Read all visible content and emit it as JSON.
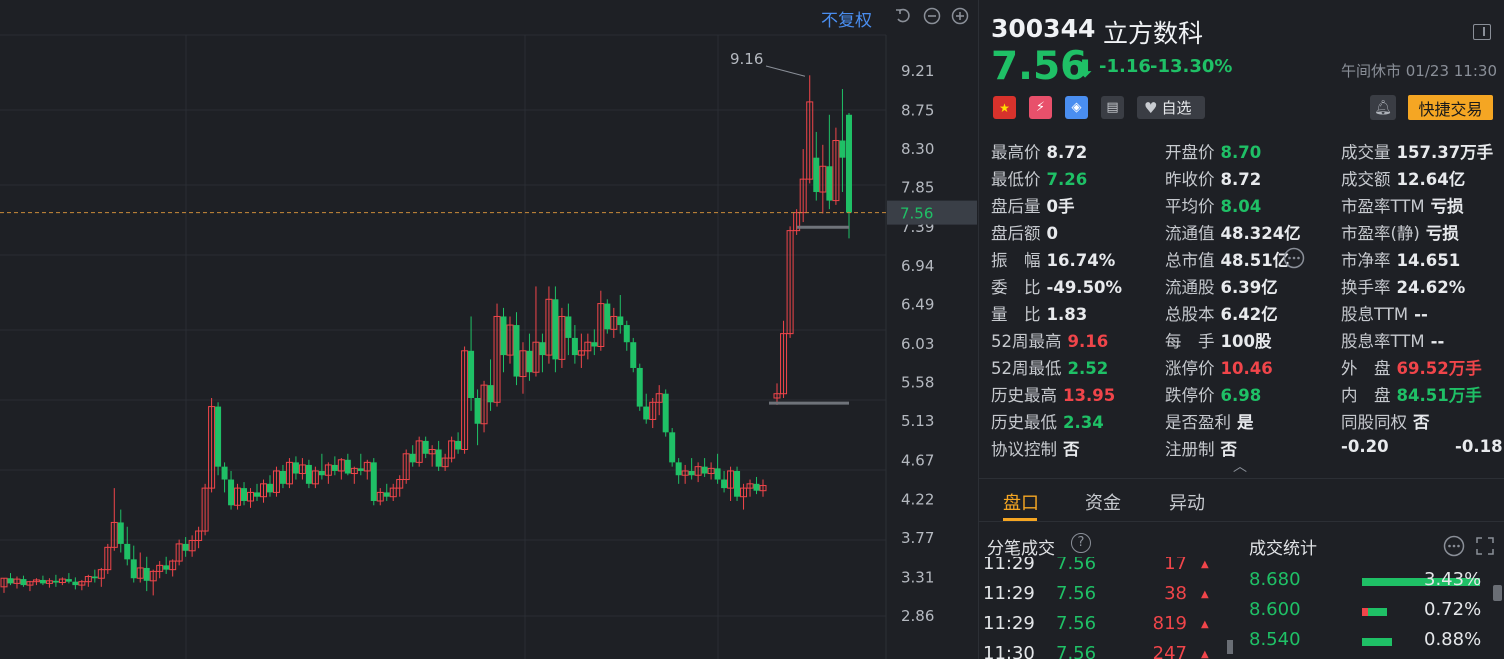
{
  "chart_data": {
    "type": "candlestick",
    "y_ticks": [
      "9.21",
      "8.75",
      "8.30",
      "7.85",
      "7.56",
      "7.39",
      "6.94",
      "6.49",
      "6.03",
      "5.58",
      "5.13",
      "4.67",
      "4.22",
      "3.77",
      "3.31",
      "2.86"
    ],
    "ylim": [
      2.86,
      9.21
    ],
    "current_price": 7.56,
    "max_label": "9.16",
    "up_color": "#f0454a",
    "down_color": "#1fc066",
    "candles": [
      [
        3.2,
        3.3,
        3.13,
        3.3
      ],
      [
        3.3,
        3.36,
        3.22,
        3.24
      ],
      [
        3.24,
        3.32,
        3.18,
        3.29
      ],
      [
        3.29,
        3.33,
        3.2,
        3.22
      ],
      [
        3.22,
        3.27,
        3.15,
        3.26
      ],
      [
        3.26,
        3.3,
        3.22,
        3.28
      ],
      [
        3.28,
        3.33,
        3.22,
        3.24
      ],
      [
        3.24,
        3.3,
        3.19,
        3.27
      ],
      [
        3.27,
        3.34,
        3.2,
        3.25
      ],
      [
        3.25,
        3.31,
        3.22,
        3.29
      ],
      [
        3.29,
        3.36,
        3.24,
        3.26
      ],
      [
        3.26,
        3.31,
        3.17,
        3.22
      ],
      [
        3.22,
        3.28,
        3.16,
        3.26
      ],
      [
        3.26,
        3.34,
        3.2,
        3.32
      ],
      [
        3.32,
        3.4,
        3.25,
        3.3
      ],
      [
        3.3,
        3.42,
        3.2,
        3.4
      ],
      [
        3.4,
        3.7,
        3.35,
        3.66
      ],
      [
        3.66,
        4.35,
        3.62,
        3.95
      ],
      [
        3.95,
        4.1,
        3.6,
        3.7
      ],
      [
        3.7,
        3.9,
        3.45,
        3.52
      ],
      [
        3.52,
        3.68,
        3.25,
        3.3
      ],
      [
        3.3,
        3.6,
        3.25,
        3.42
      ],
      [
        3.42,
        3.55,
        3.15,
        3.27
      ],
      [
        3.27,
        3.4,
        3.1,
        3.38
      ],
      [
        3.38,
        3.5,
        3.3,
        3.45
      ],
      [
        3.45,
        3.55,
        3.35,
        3.4
      ],
      [
        3.4,
        3.52,
        3.32,
        3.5
      ],
      [
        3.5,
        3.75,
        3.45,
        3.7
      ],
      [
        3.7,
        3.78,
        3.55,
        3.62
      ],
      [
        3.62,
        3.8,
        3.55,
        3.74
      ],
      [
        3.74,
        3.9,
        3.65,
        3.85
      ],
      [
        3.85,
        4.4,
        3.8,
        4.35
      ],
      [
        4.35,
        5.4,
        4.3,
        5.3
      ],
      [
        5.3,
        5.35,
        4.5,
        4.6
      ],
      [
        4.6,
        4.65,
        4.3,
        4.45
      ],
      [
        4.45,
        4.55,
        4.1,
        4.15
      ],
      [
        4.15,
        4.4,
        4.1,
        4.35
      ],
      [
        4.35,
        4.42,
        4.15,
        4.2
      ],
      [
        4.2,
        4.35,
        4.12,
        4.3
      ],
      [
        4.3,
        4.4,
        4.2,
        4.25
      ],
      [
        4.25,
        4.45,
        4.18,
        4.4
      ],
      [
        4.4,
        4.5,
        4.25,
        4.3
      ],
      [
        4.3,
        4.6,
        4.25,
        4.55
      ],
      [
        4.55,
        4.62,
        4.35,
        4.4
      ],
      [
        4.4,
        4.7,
        4.35,
        4.65
      ],
      [
        4.65,
        4.72,
        4.45,
        4.52
      ],
      [
        4.52,
        4.7,
        4.45,
        4.62
      ],
      [
        4.62,
        4.68,
        4.35,
        4.4
      ],
      [
        4.4,
        4.6,
        4.35,
        4.55
      ],
      [
        4.55,
        4.75,
        4.45,
        4.5
      ],
      [
        4.5,
        4.65,
        4.4,
        4.62
      ],
      [
        4.62,
        4.72,
        4.5,
        4.55
      ],
      [
        4.55,
        4.7,
        4.45,
        4.68
      ],
      [
        4.68,
        4.75,
        4.5,
        4.52
      ],
      [
        4.52,
        4.6,
        4.4,
        4.58
      ],
      [
        4.58,
        4.75,
        4.5,
        4.55
      ],
      [
        4.55,
        4.68,
        4.45,
        4.65
      ],
      [
        4.65,
        4.7,
        4.15,
        4.2
      ],
      [
        4.2,
        4.35,
        4.15,
        4.3
      ],
      [
        4.3,
        4.4,
        4.2,
        4.25
      ],
      [
        4.25,
        4.4,
        4.2,
        4.35
      ],
      [
        4.35,
        4.5,
        4.25,
        4.45
      ],
      [
        4.45,
        4.8,
        4.4,
        4.75
      ],
      [
        4.75,
        4.85,
        4.6,
        4.65
      ],
      [
        4.65,
        4.95,
        4.6,
        4.9
      ],
      [
        4.9,
        4.95,
        4.7,
        4.75
      ],
      [
        4.75,
        4.85,
        4.6,
        4.8
      ],
      [
        4.8,
        4.9,
        4.55,
        4.6
      ],
      [
        4.6,
        4.75,
        4.55,
        4.7
      ],
      [
        4.7,
        4.95,
        4.65,
        4.9
      ],
      [
        4.9,
        5.0,
        4.75,
        4.8
      ],
      [
        4.8,
        6.0,
        4.75,
        5.95
      ],
      [
        5.95,
        6.35,
        5.25,
        5.4
      ],
      [
        5.4,
        5.5,
        4.85,
        5.1
      ],
      [
        5.1,
        5.6,
        5.0,
        5.55
      ],
      [
        5.55,
        5.85,
        5.25,
        5.35
      ],
      [
        5.35,
        6.5,
        5.3,
        6.35
      ],
      [
        6.35,
        6.45,
        5.7,
        5.9
      ],
      [
        5.9,
        6.35,
        5.8,
        6.25
      ],
      [
        6.25,
        6.4,
        5.55,
        5.65
      ],
      [
        5.65,
        6.05,
        5.45,
        5.95
      ],
      [
        5.95,
        6.15,
        5.6,
        5.7
      ],
      [
        5.7,
        6.7,
        5.65,
        6.05
      ],
      [
        6.05,
        6.15,
        5.7,
        5.9
      ],
      [
        5.9,
        6.7,
        5.8,
        6.55
      ],
      [
        6.55,
        6.7,
        5.7,
        5.85
      ],
      [
        5.85,
        6.45,
        5.75,
        6.35
      ],
      [
        6.35,
        6.5,
        5.9,
        6.1
      ],
      [
        6.1,
        6.25,
        5.8,
        5.9
      ],
      [
        5.9,
        6.15,
        5.75,
        5.95
      ],
      [
        5.95,
        6.15,
        5.85,
        6.05
      ],
      [
        6.05,
        6.2,
        5.9,
        6.0
      ],
      [
        6.0,
        6.65,
        5.95,
        6.5
      ],
      [
        6.5,
        6.55,
        6.15,
        6.2
      ],
      [
        6.2,
        6.45,
        6.1,
        6.35
      ],
      [
        6.35,
        6.6,
        6.15,
        6.25
      ],
      [
        6.25,
        6.3,
        5.95,
        6.05
      ],
      [
        6.05,
        6.1,
        5.7,
        5.75
      ],
      [
        5.75,
        5.8,
        5.25,
        5.3
      ],
      [
        5.3,
        5.45,
        5.1,
        5.15
      ],
      [
        5.15,
        5.4,
        5.05,
        5.35
      ],
      [
        5.35,
        5.55,
        5.2,
        5.45
      ],
      [
        5.45,
        5.5,
        4.95,
        5.0
      ],
      [
        5.0,
        5.05,
        4.6,
        4.65
      ],
      [
        4.65,
        4.7,
        4.4,
        4.5
      ],
      [
        4.5,
        4.62,
        4.4,
        4.55
      ],
      [
        4.55,
        4.7,
        4.45,
        4.5
      ],
      [
        4.5,
        4.65,
        4.42,
        4.6
      ],
      [
        4.6,
        4.7,
        4.48,
        4.52
      ],
      [
        4.52,
        4.65,
        4.45,
        4.58
      ],
      [
        4.58,
        4.75,
        4.4,
        4.45
      ],
      [
        4.45,
        4.55,
        4.3,
        4.35
      ],
      [
        4.35,
        4.6,
        4.2,
        4.55
      ],
      [
        4.55,
        4.6,
        4.2,
        4.25
      ],
      [
        4.25,
        4.4,
        4.1,
        4.35
      ],
      [
        4.35,
        4.45,
        4.25,
        4.4
      ],
      [
        4.4,
        4.48,
        4.28,
        4.32
      ],
      [
        4.32,
        4.45,
        4.25,
        4.38
      ],
      [
        5.4,
        5.57,
        5.32,
        5.45
      ],
      [
        5.45,
        6.3,
        5.4,
        6.15
      ],
      [
        6.15,
        7.4,
        6.1,
        7.35
      ],
      [
        7.35,
        7.6,
        7.3,
        7.56
      ],
      [
        7.56,
        8.3,
        7.45,
        7.95
      ],
      [
        7.95,
        9.16,
        7.9,
        8.85
      ],
      [
        8.2,
        8.5,
        7.7,
        7.8
      ],
      [
        7.8,
        8.35,
        7.55,
        8.1
      ],
      [
        8.1,
        8.7,
        7.6,
        7.7
      ],
      [
        7.7,
        8.55,
        7.65,
        8.4
      ],
      [
        8.4,
        9.0,
        7.8,
        8.2
      ],
      [
        8.7,
        8.72,
        7.26,
        7.56
      ]
    ]
  },
  "top": {
    "adjust_label": "不复权"
  },
  "quote": {
    "code": "300344",
    "name": "立方数科",
    "price": "7.56",
    "change": "-1.16",
    "change_pct": "-13.30%",
    "status": "午间休市 01/23 11:30",
    "watch_label": "自选",
    "trade_label": "快捷交易"
  },
  "stats": [
    {
      "label": "最高价",
      "value": "8.72",
      "color": "white"
    },
    {
      "label": "开盘价",
      "value": "8.70",
      "color": "green"
    },
    {
      "label": "成交量",
      "value": "157.37万手",
      "color": "white"
    },
    {
      "label": "最低价",
      "value": "7.26",
      "color": "green"
    },
    {
      "label": "昨收价",
      "value": "8.72",
      "color": "white"
    },
    {
      "label": "成交额",
      "value": "12.64亿",
      "color": "white"
    },
    {
      "label": "盘后量",
      "value": "0手",
      "color": "white"
    },
    {
      "label": "平均价",
      "value": "8.04",
      "color": "green"
    },
    {
      "label": "市盈率TTM",
      "value": "亏损",
      "color": "white"
    },
    {
      "label": "盘后额",
      "value": "0",
      "color": "white"
    },
    {
      "label": "流通值",
      "value": "48.324亿",
      "color": "white"
    },
    {
      "label": "市盈率(静)",
      "value": "亏损",
      "color": "white"
    },
    {
      "label": "振　幅",
      "value": "16.74%",
      "color": "white"
    },
    {
      "label": "总市值",
      "value": "48.51亿",
      "color": "white"
    },
    {
      "label": "市净率",
      "value": "14.651",
      "color": "white"
    },
    {
      "label": "委　比",
      "value": "-49.50%",
      "color": "white"
    },
    {
      "label": "流通股",
      "value": "6.39亿",
      "color": "white"
    },
    {
      "label": "换手率",
      "value": "24.62%",
      "color": "white"
    },
    {
      "label": "量　比",
      "value": "1.83",
      "color": "white"
    },
    {
      "label": "总股本",
      "value": "6.42亿",
      "color": "white"
    },
    {
      "label": "股息TTM",
      "value": "--",
      "color": "white"
    },
    {
      "label": "52周最高",
      "value": "9.16",
      "color": "red"
    },
    {
      "label": "每　手",
      "value": "100股",
      "color": "white"
    },
    {
      "label": "股息率TTM",
      "value": "--",
      "color": "white"
    },
    {
      "label": "52周最低",
      "value": "2.52",
      "color": "green"
    },
    {
      "label": "涨停价",
      "value": "10.46",
      "color": "red"
    },
    {
      "label": "外　盘",
      "value": "69.52万手",
      "color": "red"
    },
    {
      "label": "历史最高",
      "value": "13.95",
      "color": "red"
    },
    {
      "label": "跌停价",
      "value": "6.98",
      "color": "green"
    },
    {
      "label": "内　盘",
      "value": "84.51万手",
      "color": "green"
    },
    {
      "label": "历史最低",
      "value": "2.34",
      "color": "green"
    },
    {
      "label": "是否盈利",
      "value": "是",
      "color": "white"
    },
    {
      "label": "同股同权",
      "value": "否",
      "color": "white"
    },
    {
      "label": "协议控制",
      "value": "否",
      "color": "white"
    },
    {
      "label": "注册制",
      "value": "否",
      "color": "white"
    }
  ],
  "extra_values": [
    "-0.20",
    "-0.18"
  ],
  "tabs": [
    "盘口",
    "资金",
    "异动"
  ],
  "ticks_title": "分笔成交",
  "stats_title": "成交统计",
  "ticks": [
    {
      "time": "11:29",
      "price": "7.56",
      "vol": "17"
    },
    {
      "time": "11:29",
      "price": "7.56",
      "vol": "38"
    },
    {
      "time": "11:29",
      "price": "7.56",
      "vol": "819"
    },
    {
      "time": "11:30",
      "price": "7.56",
      "vol": "247"
    }
  ],
  "distribution": [
    {
      "price": "8.680",
      "pct": "3.43%",
      "share": 0.0343
    },
    {
      "price": "8.600",
      "pct": "0.72%",
      "share": 0.0072
    },
    {
      "price": "8.540",
      "pct": "0.88%",
      "share": 0.0088
    }
  ]
}
